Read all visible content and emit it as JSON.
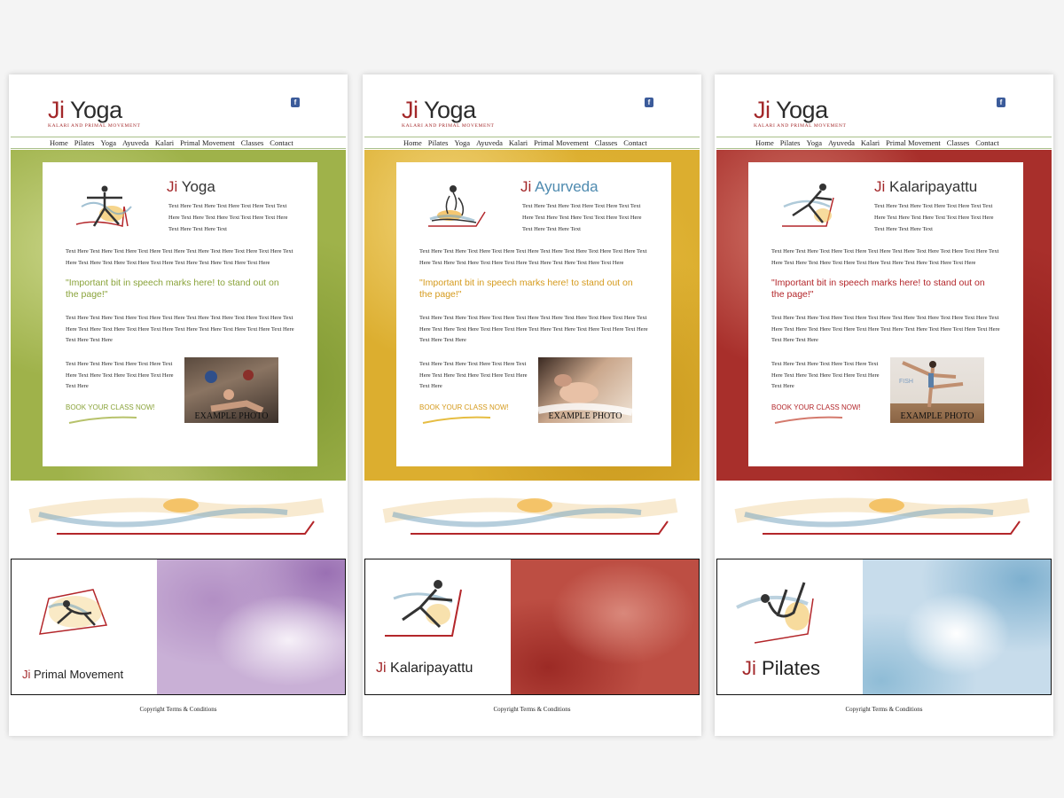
{
  "mockups": [
    {
      "logo": {
        "ji": "Ji",
        "yoga": "Yoga",
        "tagline": "Kalari and primal movement"
      },
      "facebook_glyph": "f",
      "nav": [
        "Home",
        "Pilates",
        "Yoga",
        "Ayuveda",
        "Kalari",
        "Primal Movement",
        "Classes",
        "Contact"
      ],
      "card": {
        "title_ji": "Ji",
        "title_name": "Yoga",
        "intro": "Text Here Text Here Text Here Text Here Text Text Here Text Here Text Here Text Text Here Text Here Text Here Text Here Text",
        "para1": "Text Here Text Here Text Here Text Here Text Here Text Here Text Here Text Here Text Here Text Here Text Here Text Here Text Here Text Here Text Here Text Here Text Here Text Here",
        "quote": "\"Important bit in speech marks here! to stand out on the page!\"",
        "para2": "Text Here Text Here Text Here Text Here Text Here Text Here Text Here Text Here Text Here Text Here Text Here Text Here Text Here Text Here Text Here Text Here Text Here Text Here Text Here Text Here Text Here",
        "para3": "Text Here Text Here Text Here Text Here Text Here Text Here Text Here Text Here Text Here Text Here",
        "book": "BOOK YOUR CLASS NOW!",
        "photo_caption": "EXAMPLE PHOTO"
      },
      "promo": {
        "ji": "Ji",
        "name": "Primal Movement"
      },
      "footer": "Copyright Terms & Conditions"
    },
    {
      "logo": {
        "ji": "Ji",
        "yoga": "Yoga",
        "tagline": "Kalari and primal movement"
      },
      "facebook_glyph": "f",
      "nav": [
        "Home",
        "Pilates",
        "Yoga",
        "Ayuveda",
        "Kalari",
        "Primal Movement",
        "Classes",
        "Contact"
      ],
      "card": {
        "title_ji": "Ji",
        "title_name": "Ayurveda",
        "intro": "Text Here Text Here Text Here Text Here Text Text Here Text Here Text Here Text Text Here Text Here Text Here Text Here Text",
        "para1": "Text Here Text Here Text Here Text Here Text Here Text Here Text Here Text Here Text Here Text Here Text Here Text Here Text Here Text Here Text Here Text Here Text Here Text Here",
        "quote": "\"Important bit in speech marks here! to stand out on the page!\"",
        "para2": "Text Here Text Here Text Here Text Here Text Here Text Here Text Here Text Here Text Here Text Here Text Here Text Here Text Here Text Here Text Here Text Here Text Here Text Here Text Here Text Here Text Here",
        "para3": "Text Here Text Here Text Here Text Here Text Here Text Here Text Here Text Here Text Here Text Here",
        "book": "BOOK YOUR CLASS NOW!",
        "photo_caption": "EXAMPLE PHOTO"
      },
      "promo": {
        "ji": "Ji",
        "name": "Kalaripayattu"
      },
      "footer": "Copyright Terms & Conditions"
    },
    {
      "logo": {
        "ji": "Ji",
        "yoga": "Yoga",
        "tagline": "Kalari and primal movement"
      },
      "facebook_glyph": "f",
      "nav": [
        "Home",
        "Pilates",
        "Yoga",
        "Ayuveda",
        "Kalari",
        "Primal Movement",
        "Classes",
        "Contact"
      ],
      "card": {
        "title_ji": "Ji",
        "title_name": "Kalaripayattu",
        "intro": "Text Here Text Here Text Here Text Here Text Text Here Text Here Text Here Text Text Here Text Here Text Here Text Here Text",
        "para1": "Text Here Text Here Text Here Text Here Text Here Text Here Text Here Text Here Text Here Text Here Text Here Text Here Text Here Text Here Text Here Text Here Text Here Text Here",
        "quote": "\"Important bit in speech marks here! to stand out on the page!\"",
        "para2": "Text Here Text Here Text Here Text Here Text Here Text Here Text Here Text Here Text Here Text Here Text Here Text Here Text Here Text Here Text Here Text Here Text Here Text Here Text Here Text Here Text Here",
        "para3": "Text Here Text Here Text Here Text Here Text Here Text Here Text Here Text Here Text Here Text Here",
        "book": "BOOK YOUR CLASS NOW!",
        "photo_caption": "EXAMPLE PHOTO",
        "photo_sign": "FISH"
      },
      "promo": {
        "ji": "Ji",
        "name": "Pilates"
      },
      "footer": "Copyright Terms & Conditions"
    }
  ],
  "colors": {
    "brand_red": "#a3282a",
    "green_accent": "#8aa33a",
    "yellow_accent": "#d59a1c",
    "red_accent": "#b3262a"
  }
}
